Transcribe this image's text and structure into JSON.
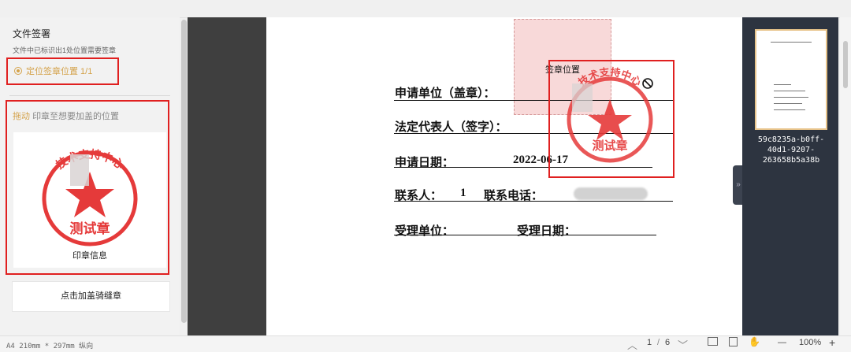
{
  "left_panel": {
    "title": "文件签署",
    "subtitle": "文件中已标识出1处位置需要签章",
    "locate_label": "定位签章位置 1/1",
    "drag_hint_prefix": "拖动",
    "drag_hint_rest": "印章至想要加盖的位置",
    "seal_label": "印章信息",
    "seal_text": "测试章",
    "seal_arc_text": "技术支持中心",
    "perforation_button": "点击加盖骑缝章"
  },
  "document": {
    "applicant_label": "申请单位（盖章）：",
    "legal_rep_label": "法定代表人（签字）：",
    "date_label": "申请日期：",
    "date_value": "2022-06-17",
    "contact_label": "联系人：",
    "contact_value": "1",
    "phone_label": "联系电话：",
    "receiver_label": "受理单位：",
    "receive_date_label": "受理日期：",
    "sign_position_label": "签章位置",
    "placed_seal_text": "测试章",
    "placed_seal_arc_text": "技术支持中心"
  },
  "thumbnail_panel": {
    "filename": "59c8235a-b0ff-\n40d1-9207-\n263658b5a38b"
  },
  "status_bar": {
    "paper_info": "A4 210mm * 297mm 纵向",
    "page_current": "1",
    "page_separator": "/",
    "page_total": "6",
    "zoom": "100%",
    "minus": "—",
    "plus": "+"
  },
  "colors": {
    "accent": "#d4a24a",
    "seal_red": "#e53a3a",
    "highlight_box": "#e02020",
    "panel_dark": "#2d3440"
  },
  "icons": [
    "radio-dot-icon",
    "forbid-icon",
    "chevron-up-icon",
    "chevron-down-icon",
    "fit-page-icon",
    "fit-width-icon",
    "hand-icon",
    "expand-icon"
  ]
}
